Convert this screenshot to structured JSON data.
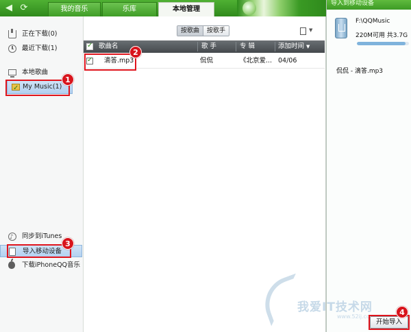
{
  "top_tabs": {
    "back_glyph": "◀",
    "refresh_glyph": "⟳",
    "my_music": "我的音乐",
    "library": "乐库",
    "local_manage": "本地管理"
  },
  "sidebar": {
    "downloading": "正在下载(0)",
    "recent_downloads": "最近下载(1)",
    "local_songs_header": "本地歌曲",
    "my_music": "My Music(1)",
    "sync_itunes": "同步到iTunes",
    "import_device": "导入移动设备",
    "download_iphone": "下载iPhoneQQ音乐"
  },
  "sort": {
    "by_song": "按歌曲",
    "by_artist": "按歌手",
    "more_glyph": "▼"
  },
  "table": {
    "columns": {
      "song": "歌曲名",
      "artist": "歌 手",
      "album": "专 辑",
      "added": "添加时间",
      "sort_glyph": "▼"
    },
    "rows": [
      {
        "song": "滴答.mp3",
        "artist": "侃侃",
        "album": "《北京爱...",
        "added": "04/06"
      }
    ]
  },
  "right_panel": {
    "title": "导入到移动设备",
    "device_path": "F:\\QQMusic",
    "space": "220M可用 共3.7G",
    "capacity_used_fraction": 0.94,
    "file_item": "侃侃 - 滴答.mp3",
    "start_button": "开始导入"
  },
  "watermark": {
    "text": "我爱IT技术网",
    "url": "www.52ij.com"
  },
  "badges": [
    "1",
    "2",
    "3",
    "4"
  ]
}
